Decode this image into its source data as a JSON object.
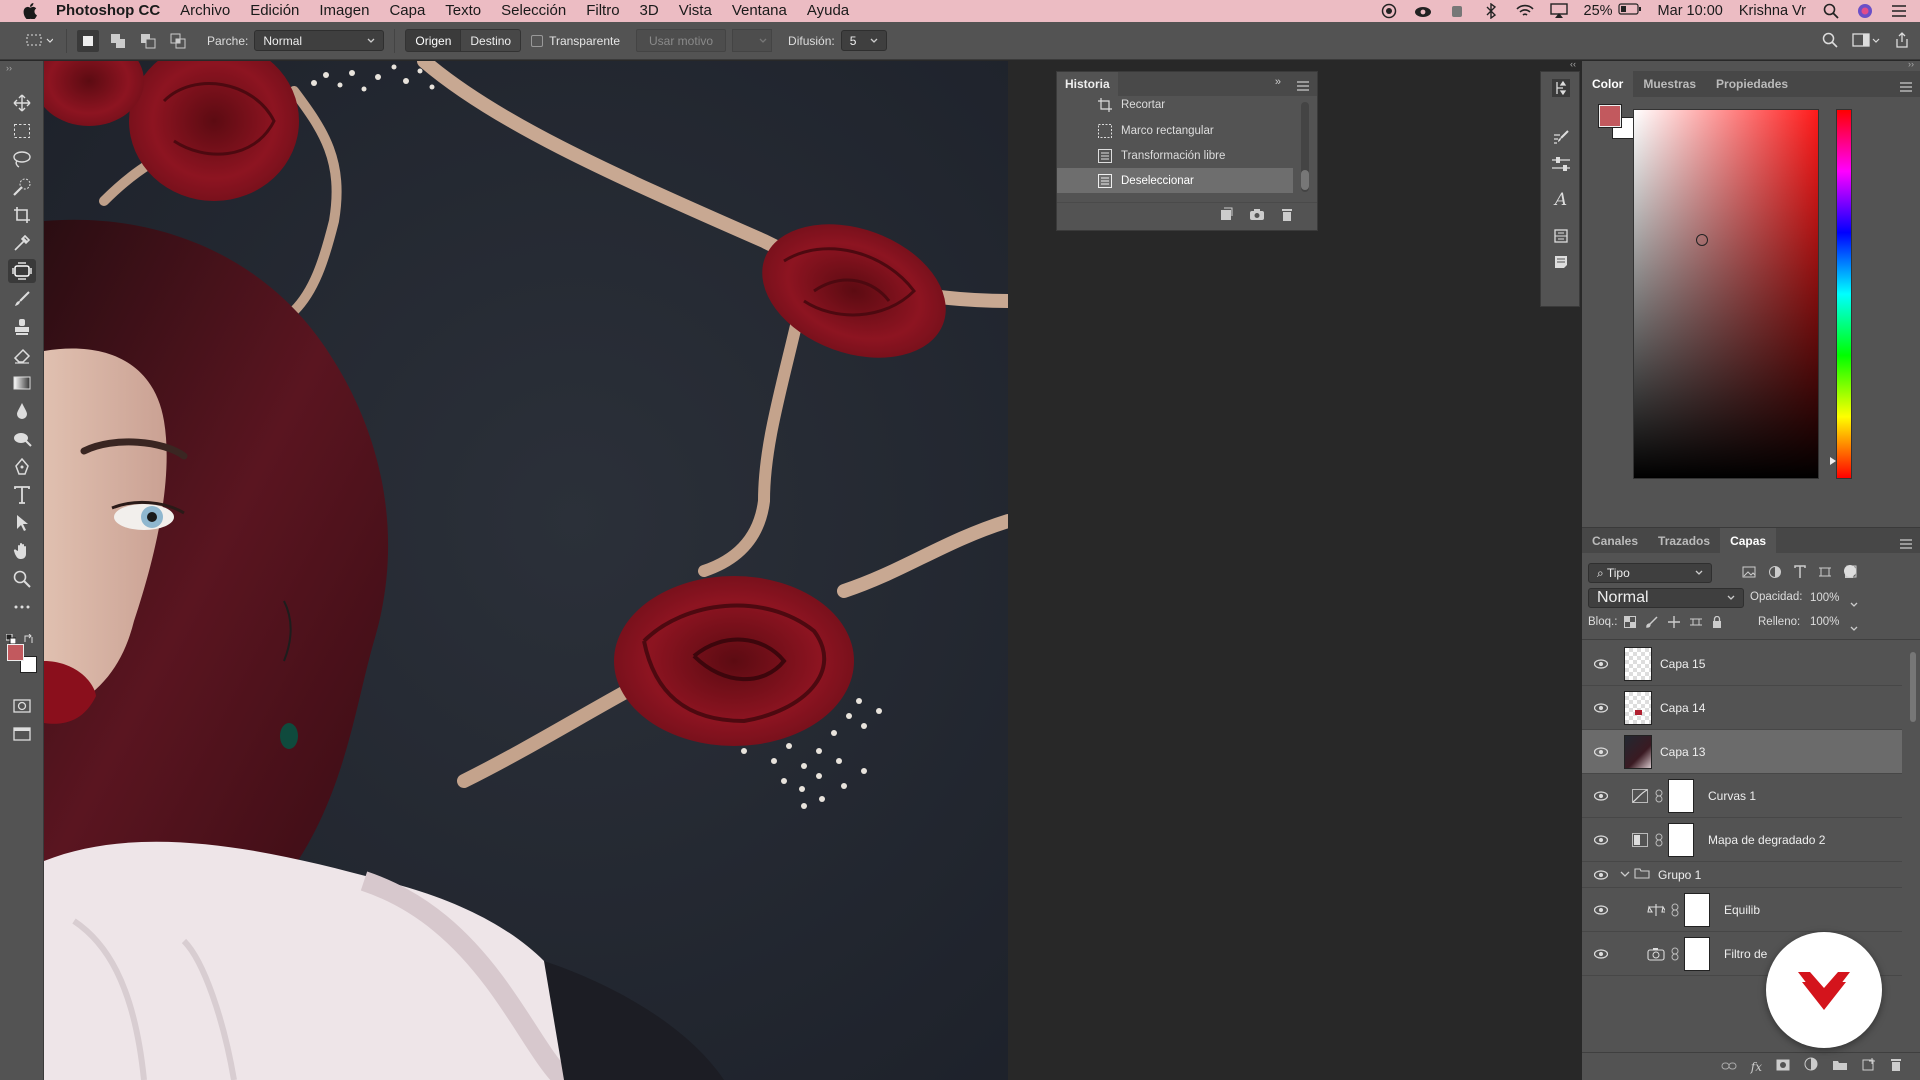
{
  "menubar": {
    "app_name": "Photoshop CC",
    "menus": [
      "Archivo",
      "Edición",
      "Imagen",
      "Capa",
      "Texto",
      "Selección",
      "Filtro",
      "3D",
      "Vista",
      "Ventana",
      "Ayuda"
    ],
    "battery": "25%",
    "clock": "Mar 10:00",
    "user": "Krishna Vr"
  },
  "options": {
    "patch_label": "Parche:",
    "patch_value": "Normal",
    "source_label": "Origen",
    "dest_label": "Destino",
    "transparent_label": "Transparente",
    "use_pattern_label": "Usar motivo",
    "diffusion_label": "Difusión:",
    "diffusion_value": "5"
  },
  "history": {
    "title": "Historia",
    "items": [
      {
        "label": "Recortar"
      },
      {
        "label": "Marco rectangular"
      },
      {
        "label": "Transformación libre"
      },
      {
        "label": "Deseleccionar"
      }
    ]
  },
  "color_panel": {
    "tabs": [
      "Color",
      "Muestras",
      "Propiedades"
    ],
    "foreground": "#c2595e",
    "hue": "#ff1a1a"
  },
  "layers_panel": {
    "tabs": [
      "Canales",
      "Trazados",
      "Capas"
    ],
    "filter_label": "Tipo",
    "blend_mode": "Normal",
    "opacity_label": "Opacidad:",
    "opacity_value": "100%",
    "lock_label": "Bloq.:",
    "fill_label": "Relleno:",
    "fill_value": "100%",
    "layers": [
      {
        "name": "Capa 15"
      },
      {
        "name": "Capa 14"
      },
      {
        "name": "Capa 13"
      },
      {
        "name": "Curvas 1"
      },
      {
        "name": "Mapa de degradado 2"
      },
      {
        "name": "Grupo 1"
      },
      {
        "name": "Equilib"
      },
      {
        "name": "Filtro de"
      }
    ]
  },
  "colors": {
    "menubar_bg": "#ecbcc3",
    "panel_bg": "#535353",
    "dark_bg": "#282828",
    "logo_red": "#d4141c"
  }
}
